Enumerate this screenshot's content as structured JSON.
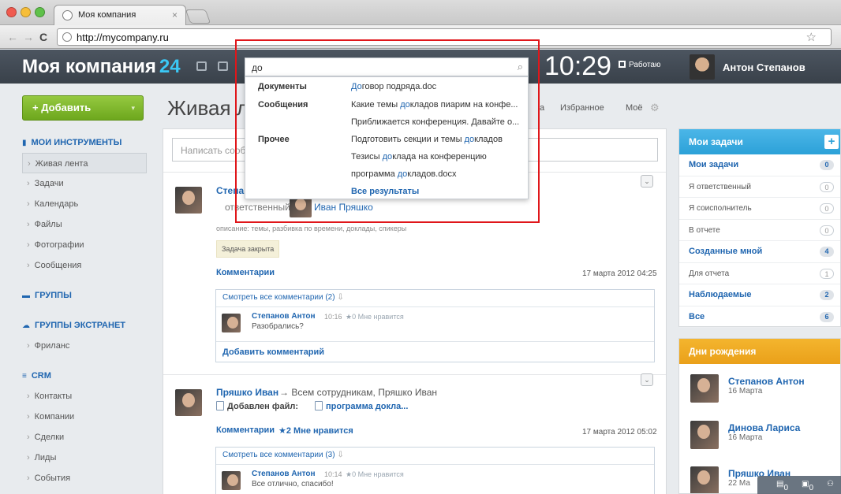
{
  "browser": {
    "tab_title": "Моя компания",
    "tab_close": "×",
    "url": "http://mycompany.ru",
    "back": "←",
    "forward": "→",
    "reload": "C",
    "star": "☆"
  },
  "header": {
    "brand": "Моя компания",
    "brand_num": "24",
    "clock": "10:29",
    "work_status": "Работаю",
    "user_name": "Антон Степанов"
  },
  "search": {
    "query": "до",
    "categories": [
      {
        "label": "Документы",
        "items": [
          [
            "",
            "До",
            "говор подряда.doc"
          ]
        ]
      },
      {
        "label": "Сообщения",
        "items": [
          [
            "Какие темы ",
            "до",
            "кладов пиарим на конфе..."
          ],
          [
            "Приближается конференция. Давайте о...",
            "",
            ""
          ]
        ]
      },
      {
        "label": "Прочее",
        "items": [
          [
            "Подготовить секции и темы ",
            "до",
            "кладов"
          ],
          [
            "Тезисы ",
            "до",
            "клада на конференцию"
          ],
          [
            "программа ",
            "до",
            "кладов.docx"
          ]
        ]
      }
    ],
    "all_results": "Все результаты"
  },
  "sidebar": {
    "add_button": "Добавить",
    "add_arrow": "▾",
    "sections": [
      {
        "head": "Мои инструменты",
        "icon": "▮",
        "items": [
          "Живая лента",
          "Задачи",
          "Календарь",
          "Файлы",
          "Фотографии",
          "Сообщения"
        ]
      },
      {
        "head": "Группы",
        "icon": "▬",
        "items": []
      },
      {
        "head": "Группы экстранет",
        "icon": "☁",
        "items": [
          "Фриланс"
        ]
      },
      {
        "head": "CRM",
        "icon": "≡",
        "items": [
          "Контакты",
          "Компании",
          "Сделки",
          "Лиды",
          "События"
        ]
      }
    ]
  },
  "feed": {
    "title": "Живая л",
    "tabs": [
      "а",
      "Избранное",
      "Моё"
    ],
    "post_placeholder": "Написать сооб",
    "post1": {
      "author": "Степан",
      "responsible_label": "ответственный:",
      "responsible_name": "Иван Пряшко",
      "description": "описание: темы, разбивка по времени, доклады, спикеры",
      "status": "Задача закрыта",
      "comments_label": "Комментарии",
      "date": "17 марта 2012 04:25",
      "view_all": "Смотреть все комментарии (2)",
      "comment_author": "Степанов Антон",
      "comment_time": "10:16",
      "comment_likes": "★0 Мне нравится",
      "comment_text": "Разобрались?",
      "add_comment": "Добавить комментарий"
    },
    "post2": {
      "author": "Пряшко Иван",
      "recipients": "→ Всем сотрудникам, Пряшко Иван",
      "file_label": "Добавлен файл:",
      "file_name": "программа докла...",
      "comments_label": "Комментарии",
      "likes": "★2 Мне нравится",
      "date": "17 марта 2012 05:02",
      "view_all": "Смотреть все комментарии (3)",
      "comment_author": "Степанов Антон",
      "comment_time": "10:14",
      "comment_likes": "★0 Мне нравится",
      "comment_text": "Все отлично, спасибо!"
    }
  },
  "tasks": {
    "title": "Мои задачи",
    "plus": "+",
    "rows": [
      {
        "label": "Мои задачи",
        "count": "0",
        "bold": true
      },
      {
        "label": "Я ответственный",
        "count": "0",
        "bold": false
      },
      {
        "label": "Я соисполнитель",
        "count": "0",
        "bold": false
      },
      {
        "label": "В отчете",
        "count": "0",
        "bold": false
      },
      {
        "label": "Созданные мной",
        "count": "4",
        "bold": true
      },
      {
        "label": "Для отчета",
        "count": "1",
        "bold": false
      },
      {
        "label": "Наблюдаемые",
        "count": "2",
        "bold": true
      },
      {
        "label": "Все",
        "count": "6",
        "bold": true
      }
    ]
  },
  "birthdays": {
    "title": "Дни рождения",
    "people": [
      {
        "name": "Степанов Антон",
        "date": "16 Марта"
      },
      {
        "name": "Динова Лариса",
        "date": "16 Марта"
      },
      {
        "name": "Пряшко Иван",
        "date": "22 Ма"
      }
    ]
  },
  "dock": {
    "messages": "0",
    "notifications": "0"
  }
}
